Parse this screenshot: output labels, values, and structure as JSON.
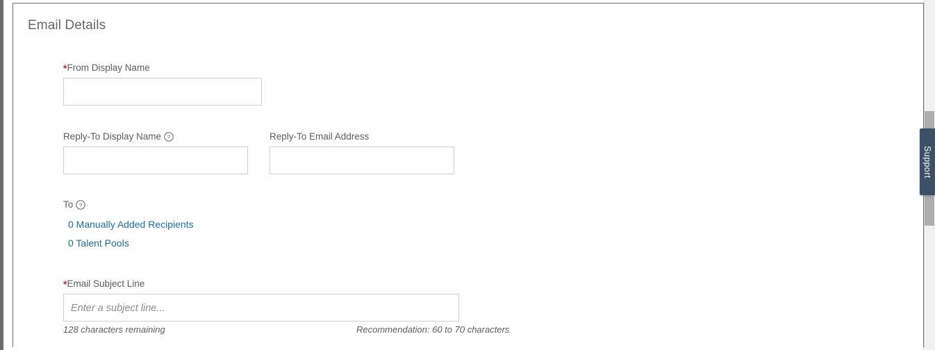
{
  "panel": {
    "section_title": "Email Details"
  },
  "fields": {
    "from_display_name": {
      "label": "From Display Name",
      "required_marker": "*",
      "value": "",
      "placeholder": ""
    },
    "reply_to_display_name": {
      "label": "Reply-To Display Name",
      "help_icon": "question-circle-icon",
      "value": "",
      "placeholder": ""
    },
    "reply_to_email_address": {
      "label": "Reply-To Email Address",
      "value": "",
      "placeholder": ""
    },
    "to": {
      "label": "To",
      "help_icon": "question-circle-icon",
      "links": [
        {
          "text": "0 Manually Added Recipients"
        },
        {
          "text": "0 Talent Pools"
        }
      ]
    },
    "email_subject_line": {
      "label": "Email Subject Line",
      "required_marker": "*",
      "value": "",
      "placeholder": "Enter a subject line...",
      "characters_remaining": "128 characters remaining",
      "recommendation": "Recommendation: 60 to 70 characters"
    }
  },
  "support_tab": {
    "label": "Support"
  },
  "colors": {
    "link": "#1b6ea5",
    "required_asterisk": "#b82c2c",
    "heading": "#666666",
    "label": "#5d5d5d",
    "input_border": "#d0d0d0",
    "support_tab_bg": "#3d5166",
    "scrollbar_thumb": "#adadad"
  }
}
